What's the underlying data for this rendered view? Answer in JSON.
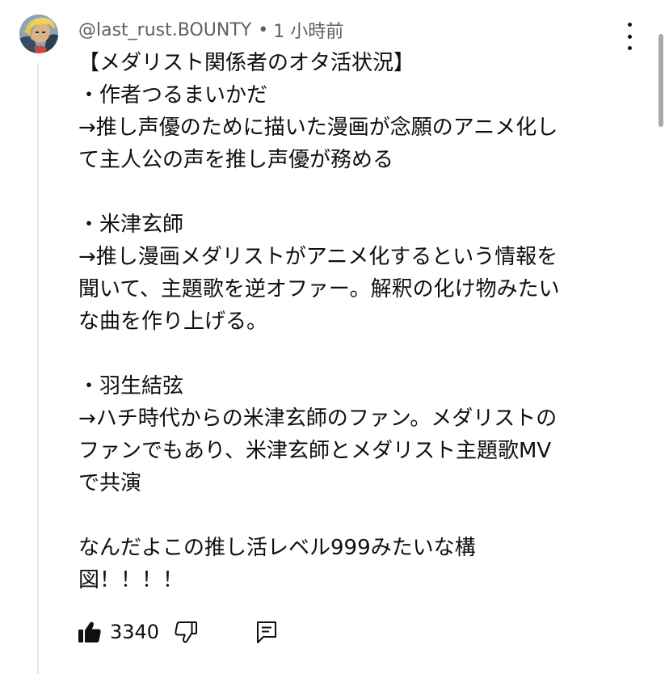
{
  "comment": {
    "author": "@last_rust.BOUNTY",
    "separator": "•",
    "timestamp": "1 小時前",
    "avatar_icon": "character-avatar",
    "menu_icon": "more-vertical-icon",
    "lines": [
      "【メダリスト関係者のオタ活状況】",
      "・作者つるまいかだ",
      "→推し声優のために描いた漫画が念願のアニメ化し",
      "て主人公の声を推し声優が務める",
      "",
      "・米津玄師",
      "→推し漫画メダリストがアニメ化するという情報を",
      "聞いて、主題歌を逆オファー。解釈の化け物みたい",
      "な曲を作り上げる。",
      "",
      "・羽生結弦",
      "→ハチ時代からの米津玄師のファン。メダリストの",
      "ファンでもあり、米津玄師とメダリスト主題歌MV",
      "で共演",
      "",
      "なんだよこの推し活レベル999みたいな構",
      "図！！！！"
    ]
  },
  "actions": {
    "like_count": "3340",
    "like_icon": "thumbs-up-filled-icon",
    "dislike_icon": "thumbs-down-icon",
    "reply_icon": "reply-comment-icon"
  }
}
